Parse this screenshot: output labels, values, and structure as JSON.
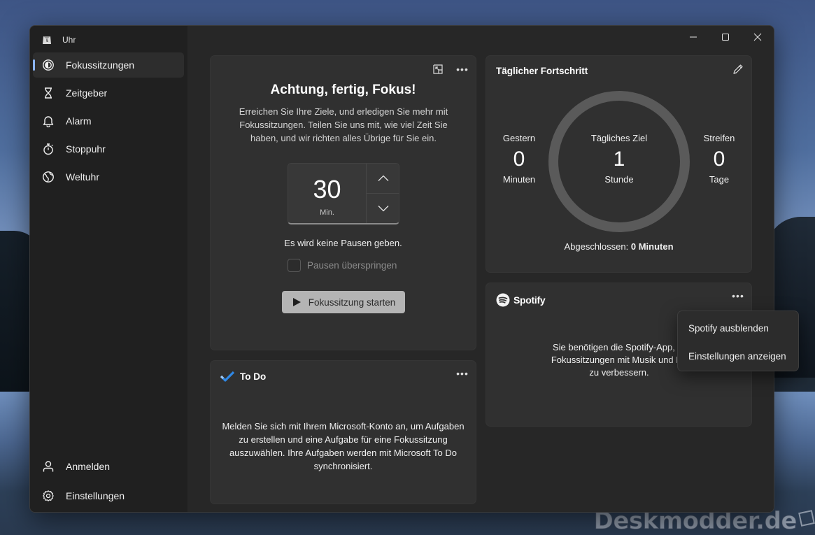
{
  "app": {
    "title": "Uhr"
  },
  "sidebar": {
    "items": [
      {
        "label": "Fokussitzungen",
        "icon": "focus-icon",
        "active": true
      },
      {
        "label": "Zeitgeber",
        "icon": "hourglass-icon"
      },
      {
        "label": "Alarm",
        "icon": "bell-icon"
      },
      {
        "label": "Stoppuhr",
        "icon": "stopwatch-icon"
      },
      {
        "label": "Weltuhr",
        "icon": "globe-icon"
      }
    ],
    "bottom_items": [
      {
        "label": "Anmelden",
        "icon": "person-icon"
      },
      {
        "label": "Einstellungen",
        "icon": "gear-icon"
      }
    ]
  },
  "focus": {
    "title": "Achtung, fertig, Fokus!",
    "description": "Erreichen Sie Ihre Ziele, und erledigen Sie mehr mit Fokussitzungen. Teilen Sie uns mit, wie viel Zeit Sie haben, und wir richten alles Übrige für Sie ein.",
    "duration_value": "30",
    "duration_unit": "Min.",
    "pause_info": "Es wird keine Pausen geben.",
    "skip_breaks_label": "Pausen überspringen",
    "start_button": "Fokussitzung starten"
  },
  "todo": {
    "title": "To Do",
    "message": "Melden Sie sich mit Ihrem Microsoft-Konto an, um Aufgaben zu erstellen und eine Aufgabe für eine Fokussitzung auszuwählen. Ihre Aufgaben werden mit Microsoft To Do synchronisiert."
  },
  "progress": {
    "title": "Täglicher Fortschritt",
    "yesterday": {
      "label": "Gestern",
      "value": "0",
      "unit": "Minuten"
    },
    "goal": {
      "label": "Tägliches Ziel",
      "value": "1",
      "unit": "Stunde"
    },
    "streak": {
      "label": "Streifen",
      "value": "0",
      "unit": "Tage"
    },
    "completed_label": "Abgeschlossen:",
    "completed_value": "0 Minuten",
    "completed_fraction": 0
  },
  "spotify": {
    "brand": "Spotify",
    "message_line1": "Sie benötigen die Spotify-App, ur",
    "message_line2": "Fokussitzungen mit Musik und Po",
    "message_line3": "zu verbessern."
  },
  "context_menu": {
    "items": [
      "Spotify ausblenden",
      "Einstellungen anzeigen"
    ]
  },
  "watermark": "Deskmodder.de",
  "colors": {
    "accent": "#8ab4f8",
    "window_bg": "#272727",
    "sidebar_bg": "#202020",
    "card_bg": "#303030",
    "ring": "#5a5a5a",
    "todo_check": "#2f88e6"
  }
}
